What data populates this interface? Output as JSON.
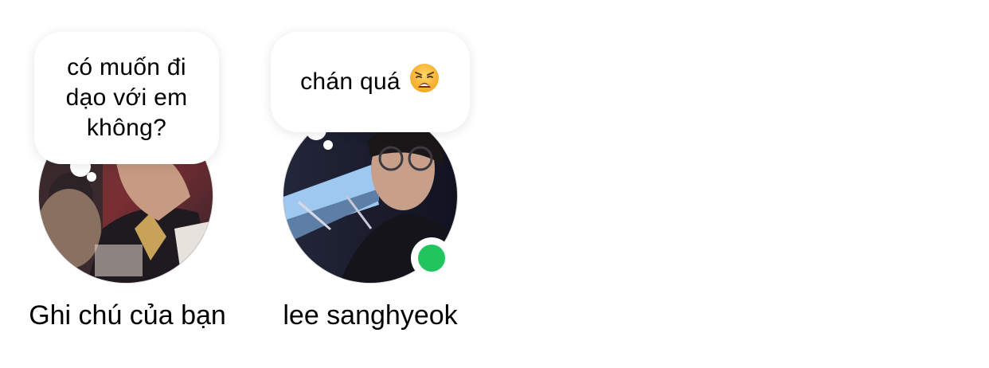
{
  "notes": [
    {
      "note_text": "có muốn đi dạo với em không?",
      "name": "Ghi chú của bạn",
      "online": false
    },
    {
      "note_text": "chán quá",
      "emoji_icon": "weary-face-icon",
      "name": "lee sanghyeok",
      "online": true
    }
  ],
  "colors": {
    "online": "#21c55d",
    "bubble_bg": "#ffffff",
    "text": "#000000"
  }
}
